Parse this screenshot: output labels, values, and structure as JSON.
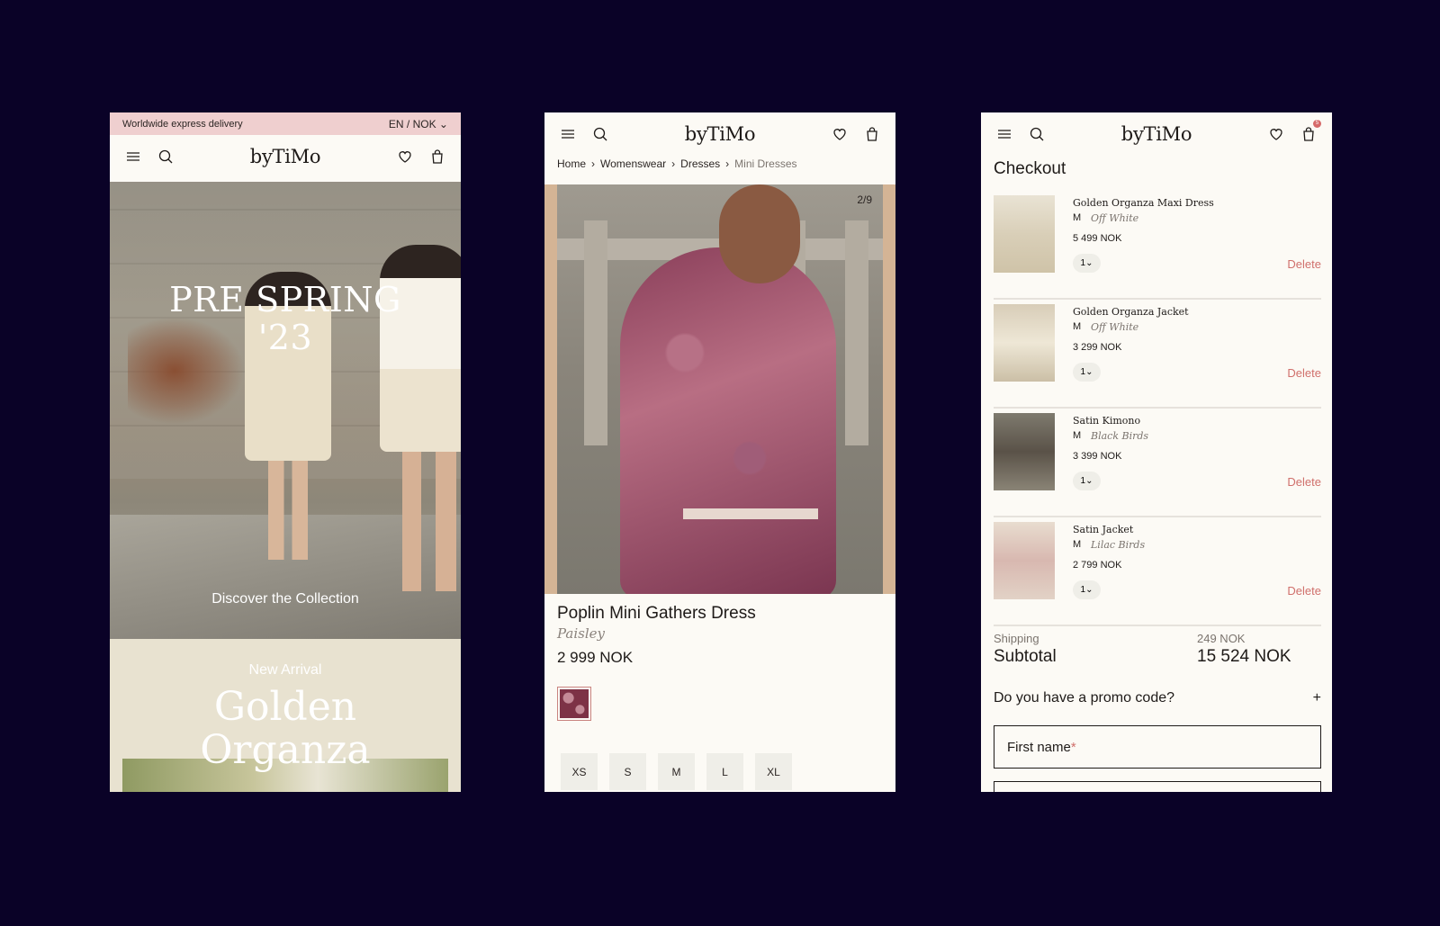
{
  "brand": "byTiMo",
  "home": {
    "promo_bar": "Worldwide express delivery",
    "locale": "EN / NOK ⌄",
    "hero_title_line1": "PRE SPRING",
    "hero_title_line2": "'23",
    "hero_cta": "Discover the Collection",
    "arrival_kicker": "New Arrival",
    "arrival_title_line1": "Golden",
    "arrival_title_line2": "Organza"
  },
  "product": {
    "breadcrumb": [
      "Home",
      "Womenswear",
      "Dresses",
      "Mini Dresses"
    ],
    "image_counter": "2/9",
    "name": "Poplin Mini Gathers Dress",
    "variant": "Paisley",
    "price": "2 999 NOK",
    "sizes": [
      "XS",
      "S",
      "M",
      "L",
      "XL"
    ]
  },
  "checkout": {
    "title": "Checkout",
    "cart_badge": "5",
    "items": [
      {
        "name": "Golden Organza Maxi Dress",
        "size": "M",
        "color": "Off White",
        "price": "5 499 NOK",
        "qty": "1",
        "delete": "Delete"
      },
      {
        "name": "Golden Organza Jacket",
        "size": "M",
        "color": "Off White",
        "price": "3 299 NOK",
        "qty": "1",
        "delete": "Delete"
      },
      {
        "name": "Satin Kimono",
        "size": "M",
        "color": "Black Birds",
        "price": "3 399 NOK",
        "qty": "1",
        "delete": "Delete"
      },
      {
        "name": "Satin Jacket",
        "size": "M",
        "color": "Lilac Birds",
        "price": "2 799 NOK",
        "qty": "1",
        "delete": "Delete"
      }
    ],
    "shipping_label": "Shipping",
    "shipping_value": "249 NOK",
    "subtotal_label": "Subtotal",
    "subtotal_value": "15 524 NOK",
    "promo_question": "Do you have a promo code?",
    "promo_plus": "+",
    "first_name_label": "First name",
    "required_mark": "*"
  },
  "colors": {
    "background": "#0a0227",
    "page": "#fcfaf5",
    "promo_bar": "#efcfcf",
    "accent": "#d0706c"
  }
}
